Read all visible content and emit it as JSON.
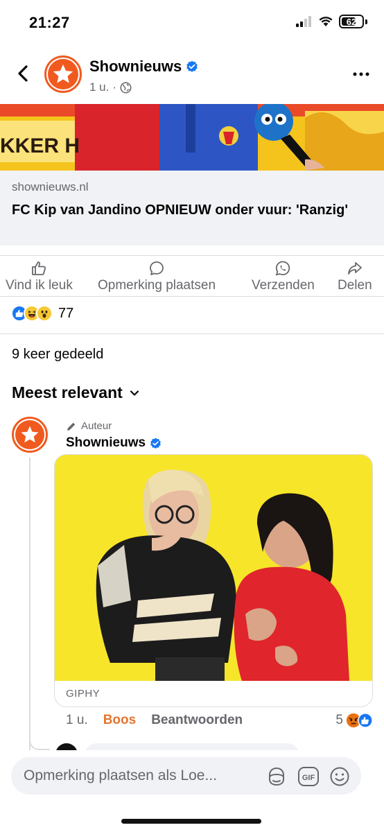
{
  "status_bar": {
    "time": "21:27",
    "battery": "62"
  },
  "header": {
    "page_name": "Shownieuws",
    "time": "1 u.",
    "separator": "·"
  },
  "link": {
    "domain": "shownieuws.nl",
    "title": "FC Kip van Jandino OPNIEUW onder vuur: 'Ranzig'",
    "image_text": "KKER H"
  },
  "actions": {
    "like": "Vind ik leuk",
    "comment": "Opmerking plaatsen",
    "send": "Verzenden",
    "share": "Delen"
  },
  "reactions": {
    "count": "77"
  },
  "shares": "9 keer gedeeld",
  "sort": "Meest relevant",
  "comment": {
    "badge": "Auteur",
    "author": "Shownieuws",
    "gif_source": "GIPHY",
    "time": "1 u.",
    "reaction_label": "Boos",
    "reply_label": "Beantwoorden",
    "reaction_count": "5"
  },
  "composer": {
    "placeholder": "Opmerking plaatsen als Loe..."
  },
  "colors": {
    "brand_orange": "#f05a1f",
    "fb_blue": "#1877f2",
    "boos_orange": "#e4752f",
    "text_secondary": "#65676b",
    "gif_bg": "#f7e52a"
  }
}
